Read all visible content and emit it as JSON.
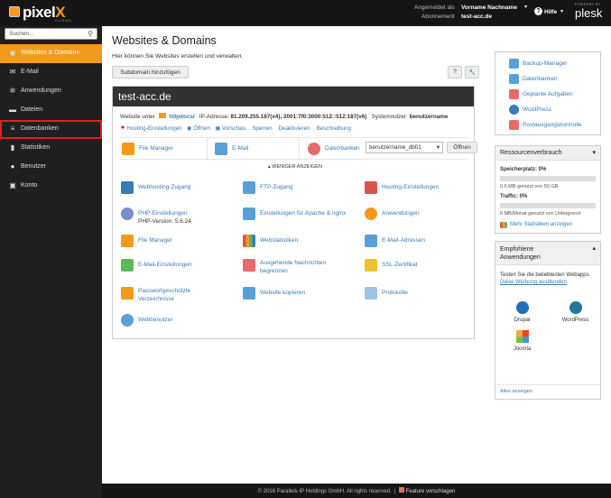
{
  "header": {
    "brand": "pixel",
    "brand_x": "X",
    "brand_sub": "CLOUD",
    "logged_in_label": "Angemeldet als",
    "user_name": "Vorname Nachname",
    "subscription_label": "Abonnement",
    "subscription_value": "test-acc.de",
    "help_label": "Hilfe",
    "powered_by": "POWERED BY",
    "plesk": "plesk"
  },
  "sidebar": {
    "search_placeholder": "Suchen...",
    "items": [
      {
        "label": "Websites & Domains",
        "icon": "globe-icon",
        "active": true
      },
      {
        "label": "E-Mail",
        "icon": "mail-icon"
      },
      {
        "label": "Anwendungen",
        "icon": "gear-icon"
      },
      {
        "label": "Dateien",
        "icon": "folder-icon"
      },
      {
        "label": "Datenbanken",
        "icon": "database-icon",
        "highlighted": true
      },
      {
        "label": "Statistiken",
        "icon": "bar-chart-icon"
      },
      {
        "label": "Benutzer",
        "icon": "user-icon"
      },
      {
        "label": "Konto",
        "icon": "account-icon"
      }
    ]
  },
  "main": {
    "title": "Websites & Domains",
    "subtitle": "Hier können Sie Websites erstellen und verwalten.",
    "add_subdomain": "Subdomain hinzufügen",
    "help_btn": "?",
    "domain": {
      "name": "test-acc.de",
      "website_under": "Website unter",
      "docroot": "httpdocs/",
      "ip_label": "IP-Adresse:",
      "ip_value": "81.209.255.187(v4), 2001:7f0:3000:512::512:187(v6)",
      "sysuser_label": "Systemnutzer:",
      "sysuser_value": "benutzername",
      "actions": [
        "Hosting-Einstellungen",
        "Öffnen",
        "Vorschau",
        "Sperren",
        "Deaktivieren",
        "Beschreibung"
      ],
      "quick": {
        "file_manager": "File Manager",
        "email": "E-Mail",
        "databases": "Datenbanken",
        "db_select": "benutzername_db01",
        "open": "Öffnen"
      },
      "less": "WENIGER ANZEIGEN",
      "tools": [
        [
          "Webhosting-Zugang",
          "FTP-Zugang",
          "Hosting-Einstellungen"
        ],
        [
          "PHP-Einstellungen",
          "Einstellungen für Apache & nginx",
          "Anwendungen"
        ],
        [
          "File Manager",
          "Webstatistiken",
          "E-Mail-Adressen"
        ],
        [
          "E-Mail-Einstellungen",
          "Ausgehende Nachrichten begrenzen",
          "SSL-Zertifikat"
        ],
        [
          "Passwortgeschützte Verzeichnisse",
          "Website kopieren",
          "Protokolle"
        ],
        [
          "Webbenutzer"
        ]
      ],
      "php_version": "PHP-Version: 5.6.24"
    }
  },
  "right": {
    "links": [
      "Backup-Manager",
      "Datenbanken",
      "Geplante Aufgaben",
      "WordPress",
      "Postausgangskontrolle"
    ],
    "resources": {
      "title": "Ressourcenverbrauch",
      "disk_label": "Speicherplatz: 0%",
      "disk_detail": "0.6 MB genutzt von 50 GB",
      "disk_fraction": 0.0,
      "traffic_label": "Traffic: 0%",
      "traffic_detail": "0 MB/Monat genutzt von Unbegrenzt",
      "traffic_fraction": 0.0,
      "more": "Mehr Statistiken anzeigen"
    },
    "apps": {
      "title": "Empfohlene Anwendungen",
      "desc": "Testen Sie die beliebtesten Webapps.",
      "hide": "Diese Werbung ausblenden",
      "items": [
        "Drupal",
        "WordPress",
        "Joomla"
      ],
      "all": "Alles anzeigen"
    }
  },
  "footer": {
    "copyright": "© 2016 Parallels IP Holdings GmbH. All rights reserved.",
    "feature": "Feature vorschlagen"
  },
  "colors": {
    "accent": "#f39a1e",
    "highlight": "#e02020",
    "link": "#3a7ab8"
  }
}
